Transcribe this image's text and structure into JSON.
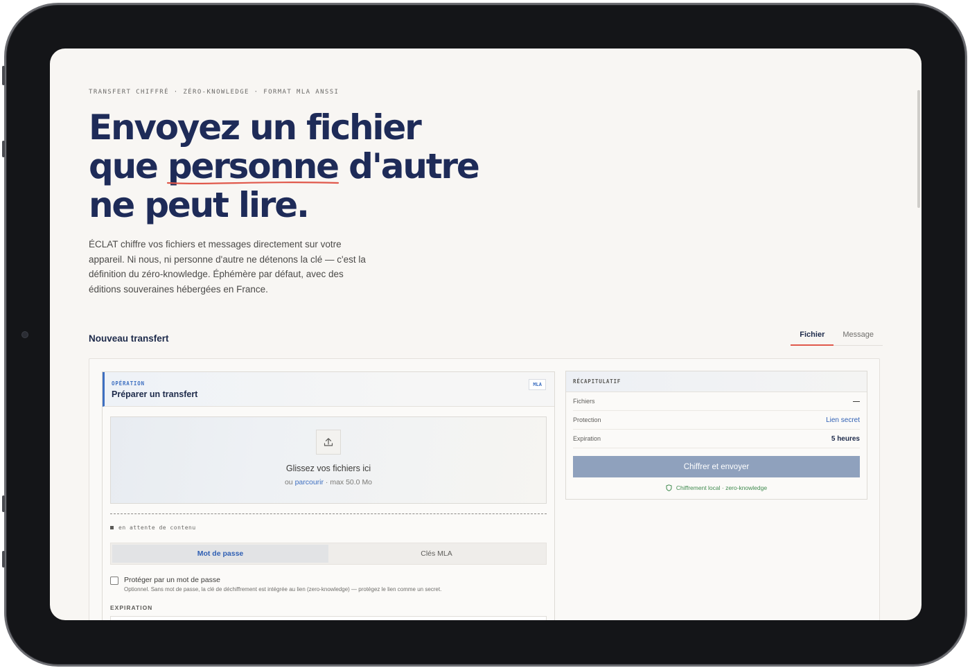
{
  "eyebrow": "TRANSFERT CHIFFRÉ · ZÉRO-KNOWLEDGE · FORMAT MLA ANSSI",
  "hero": {
    "line1": "Envoyez un fichier",
    "line2_a": "que ",
    "line2_underlined": "personne",
    "line2_b": " d'autre",
    "line3": "ne peut lire."
  },
  "lead": "ÉCLAT chiffre vos fichiers et messages directement sur votre appareil. Ni nous, ni personne d'autre ne détenons la clé — c'est la définition du zéro-knowledge. Éphémère par défaut, avec des éditions souveraines hébergées en France.",
  "section_title": "Nouveau transfert",
  "tabs": [
    {
      "label": "Fichier",
      "active": true
    },
    {
      "label": "Message",
      "active": false
    }
  ],
  "operation": {
    "kicker": "OPÉRATION",
    "title": "Préparer un transfert",
    "badge": "MLA",
    "dropzone": {
      "title": "Glissez vos fichiers ici",
      "sub_prefix": "ou ",
      "sub_link": "parcourir",
      "sub_suffix": " · max 50.0 Mo"
    },
    "status": "en attente de contenu",
    "segments": [
      {
        "label": "Mot de passe",
        "active": true
      },
      {
        "label": "Clés MLA",
        "active": false
      }
    ],
    "password_checkbox": {
      "label": "Protéger par un mot de passe",
      "help": "Optionnel. Sans mot de passe, la clé de déchiffrement est intégrée au lien (zero-knowledge) — protégez le lien comme un secret.",
      "checked": false
    },
    "expiration_label": "EXPIRATION"
  },
  "summary": {
    "kicker": "RÉCAPITULATIF",
    "rows": {
      "files_label": "Fichiers",
      "protection_label": "Protection",
      "protection_value": "Lien secret",
      "expiration_label": "Expiration",
      "expiration_value": "5 heures"
    },
    "cta": "Chiffrer et envoyer",
    "footnote": "Chiffrement local · zero-knowledge"
  },
  "colors": {
    "navy": "#1e2b58",
    "accent_blue": "#3d6fc1",
    "underline_red": "#e0584b",
    "cta_disabled": "#8fa1bd",
    "success_green": "#3f8a4e"
  }
}
